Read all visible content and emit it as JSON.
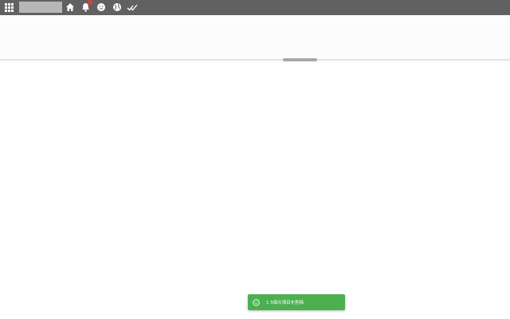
{
  "topbar": {
    "icons": {
      "apps": "apps-grid-icon",
      "home": "home-icon",
      "notifications": "bell-icon",
      "emoji": "smiley-face-icon",
      "globe": "globe-icon",
      "check": "double-check-icon"
    },
    "search": {
      "value": "",
      "placeholder": ""
    },
    "notification_badge_color": "#e53935"
  },
  "toast": {
    "message": "1 5個の項目を削除",
    "icon": "smiley-face-icon",
    "color": "#4caf50"
  },
  "colors": {
    "topbar": "#616161",
    "background": "#fcfcfc"
  }
}
